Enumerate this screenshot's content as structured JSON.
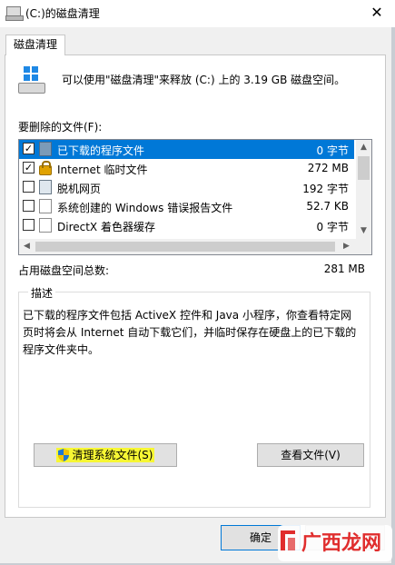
{
  "window": {
    "title": "(C:)的磁盘清理",
    "close_glyph": "✕"
  },
  "tab": {
    "label": "磁盘清理"
  },
  "summary": {
    "text": "可以使用\"磁盘清理\"来释放 (C:) 上的 3.19 GB 磁盘空间。"
  },
  "files": {
    "label": "要删除的文件(F):",
    "items": [
      {
        "checked": true,
        "name": "已下载的程序文件",
        "size": "0 字节",
        "icon": "download-folder-icon",
        "selected": true
      },
      {
        "checked": true,
        "name": "Internet 临时文件",
        "size": "272 MB",
        "icon": "lock-icon",
        "selected": false
      },
      {
        "checked": false,
        "name": "脱机网页",
        "size": "192 字节",
        "icon": "webpage-icon",
        "selected": false
      },
      {
        "checked": false,
        "name": "系统创建的 Windows 错误报告文件",
        "size": "52.7 KB",
        "icon": "document-icon",
        "selected": false
      },
      {
        "checked": false,
        "name": "DirectX 着色器缓存",
        "size": "0 字节",
        "icon": "document-icon",
        "selected": false
      }
    ],
    "check_glyph": "✓",
    "scroll_up_glyph": "▲",
    "scroll_down_glyph": "▼",
    "scroll_left_glyph": "◀",
    "scroll_right_glyph": "▶"
  },
  "total": {
    "label": "占用磁盘空间总数:",
    "value": "281 MB"
  },
  "description": {
    "legend": "描述",
    "text": "已下载的程序文件包括 ActiveX 控件和 Java 小程序，你查看特定网页时将会从 Internet 自动下载它们，并临时保存在硬盘上的已下载的程序文件夹中。"
  },
  "buttons": {
    "clean_system": "清理系统文件(S)",
    "view_files": "查看文件(V)",
    "ok": "确定"
  },
  "watermark": {
    "text": "广西龙网"
  },
  "colors": {
    "selection": "#0078d7",
    "highlight": "#f7f734",
    "watermark": "#e02d2d"
  }
}
